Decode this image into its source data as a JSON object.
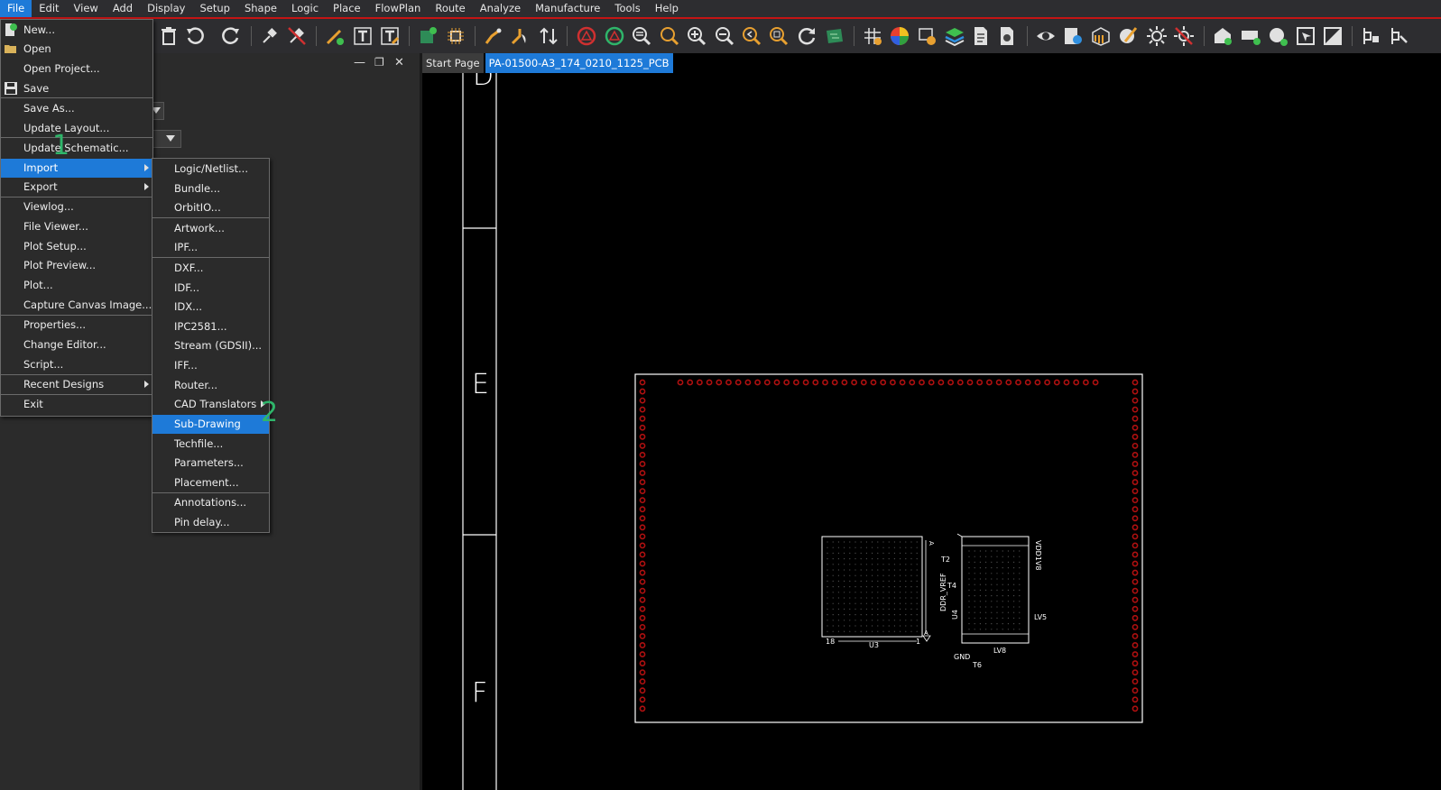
{
  "menubar": {
    "items": [
      "File",
      "Edit",
      "View",
      "Add",
      "Display",
      "Setup",
      "Shape",
      "Logic",
      "Place",
      "FlowPlan",
      "Route",
      "Analyze",
      "Manufacture",
      "Tools",
      "Help"
    ],
    "active_index": 0
  },
  "toolbar": {
    "icons": [
      "delete-icon",
      "undo-icon",
      "redo-icon",
      "pin-icon",
      "unpin-icon",
      "add-line-icon",
      "add-text-icon",
      "edit-text-icon",
      "place-component-icon",
      "chip-icon",
      "connect-icon",
      "slide-icon",
      "swap-icon",
      "drc-icon",
      "drc-update-icon",
      "zoom-fit-icon",
      "zoom-world-icon",
      "zoom-in-icon",
      "zoom-out-icon",
      "zoom-previous-icon",
      "zoom-selection-icon",
      "redraw-icon",
      "board-icon",
      "grid-icon",
      "color-icon",
      "shadow-icon",
      "layers-icon",
      "report-icon",
      "settings-icon",
      "visibility-icon",
      "info-icon",
      "3d-view-icon",
      "paint-icon",
      "light-icon",
      "highlight-off-icon",
      "add-shape-icon",
      "rectangle-icon",
      "circle-icon",
      "select-icon",
      "edit-shape-icon",
      "snap-icon",
      "pin-tool-icon"
    ]
  },
  "left_panel": {
    "minimize_glyph": "—",
    "restore_glyph": "❐",
    "close_glyph": "✕"
  },
  "tabs": [
    {
      "label": "Start Page",
      "active": false
    },
    {
      "label": "PA-01500-A3_174_0210_1125_PCB",
      "active": true
    }
  ],
  "file_menu": {
    "items": [
      {
        "label": "New...",
        "icon": "new-file-icon"
      },
      {
        "label": "Open",
        "icon": "open-folder-icon"
      },
      {
        "label": "Open Project..."
      },
      {
        "label": "Save",
        "icon": "save-icon"
      },
      {
        "label": "Save As..."
      },
      {
        "label": "Update Layout..."
      },
      {
        "label": "Update Schematic..."
      },
      {
        "label": "Import",
        "submenu": true,
        "highlighted": true
      },
      {
        "label": "Export",
        "submenu": true
      },
      {
        "label": "Viewlog..."
      },
      {
        "label": "File Viewer..."
      },
      {
        "label": "Plot Setup..."
      },
      {
        "label": "Plot Preview..."
      },
      {
        "label": "Plot..."
      },
      {
        "label": "Capture Canvas Image..."
      },
      {
        "label": "Properties..."
      },
      {
        "label": "Change Editor..."
      },
      {
        "label": "Script..."
      },
      {
        "label": "Recent Designs",
        "submenu": true
      },
      {
        "label": "Exit"
      }
    ]
  },
  "import_submenu": {
    "items": [
      {
        "label": "Logic/Netlist..."
      },
      {
        "label": "Bundle..."
      },
      {
        "label": "OrbitIO..."
      },
      {
        "label": "Artwork..."
      },
      {
        "label": "IPF..."
      },
      {
        "label": "DXF..."
      },
      {
        "label": "IDF..."
      },
      {
        "label": "IDX..."
      },
      {
        "label": "IPC2581..."
      },
      {
        "label": "Stream (GDSII)..."
      },
      {
        "label": "IFF..."
      },
      {
        "label": "Router..."
      },
      {
        "label": "CAD Translators",
        "submenu": true
      },
      {
        "label": "Sub-Drawing",
        "highlighted": true
      },
      {
        "label": "Techfile..."
      },
      {
        "label": "Parameters..."
      },
      {
        "label": "Placement..."
      },
      {
        "label": "Annotations..."
      },
      {
        "label": "Pin delay..."
      }
    ]
  },
  "step_labels": [
    "1",
    "2"
  ],
  "canvas": {
    "frame_letters": [
      "D",
      "E",
      "F"
    ],
    "labels": {
      "u3": "U3",
      "ddr_vref": "DDR_VREF",
      "t2": "T2",
      "t4": "T4",
      "u4": "U4",
      "vdd": "VDD1V8",
      "lv5": "LV5",
      "lv8": "LV8",
      "gnd": "GND",
      "t6": "T6",
      "pin18": "18",
      "pin1": "1",
      "mark_a1": "A",
      "mark_a2": "A"
    }
  },
  "colors": {
    "menu_bg": "#2b2b2b",
    "highlight": "#1e7ad8",
    "step_label": "#2fb56a",
    "pad": "#b01010",
    "menubar_accent": "#c41414"
  }
}
